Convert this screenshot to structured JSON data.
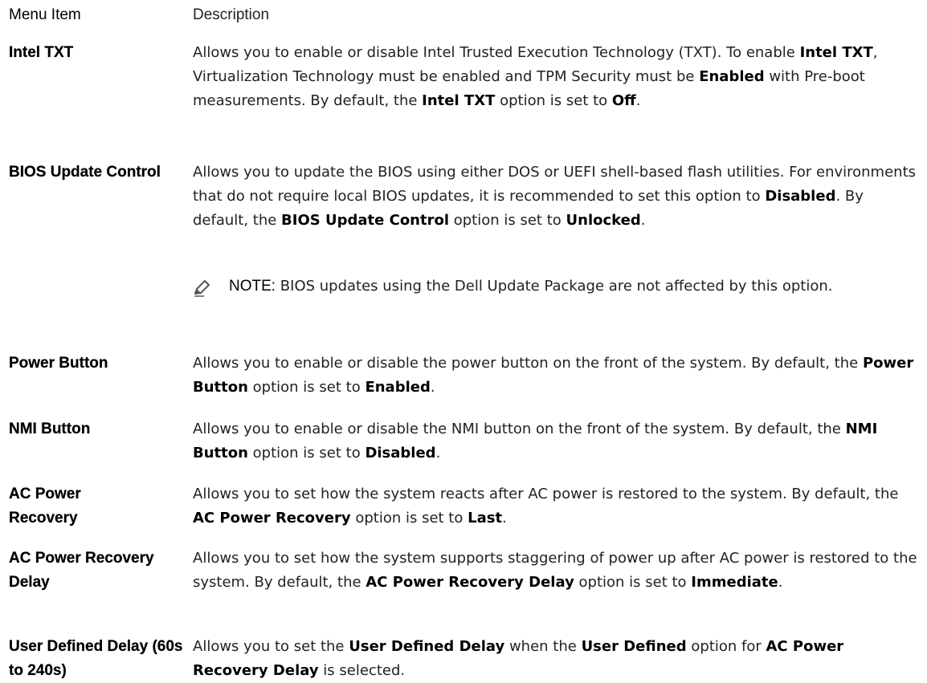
{
  "header": {
    "menu_item": "Menu Item",
    "description": "Description"
  },
  "rows": [
    {
      "item": "Intel TXT",
      "parts": [
        {
          "t": "Allows you to enable or disable Intel Trusted Execution Technology (TXT). To enable "
        },
        {
          "t": "Intel TXT",
          "b": true
        },
        {
          "t": ", Virtualization Technology must be enabled and TPM Security must be "
        },
        {
          "t": "Enabled",
          "b": true
        },
        {
          "t": " with Pre-boot measurements. By default, the "
        },
        {
          "t": "Intel TXT",
          "b": true
        },
        {
          "t": " option is set to "
        },
        {
          "t": "Off",
          "b": true
        },
        {
          "t": "."
        }
      ]
    },
    {
      "item": "BIOS Update Control",
      "parts": [
        {
          "t": "Allows you to update the BIOS using either DOS or UEFI shell-based flash utilities. For environments that do not require local BIOS updates, it is recommended to set this option to "
        },
        {
          "t": "Disabled",
          "b": true
        },
        {
          "t": ". By default, the "
        },
        {
          "t": "BIOS Update Control",
          "b": true
        },
        {
          "t": " option is set to "
        },
        {
          "t": "Unlocked",
          "b": true
        },
        {
          "t": "."
        }
      ],
      "note": {
        "label": "NOTE:",
        "text": " BIOS updates using the Dell Update Package are not affected by this option."
      }
    },
    {
      "item": "Power Button",
      "parts": [
        {
          "t": "Allows you to enable or disable the power button on the front of the system. By default, the "
        },
        {
          "t": "Power Button",
          "b": true
        },
        {
          "t": " option is set to "
        },
        {
          "t": "Enabled",
          "b": true
        },
        {
          "t": "."
        }
      ]
    },
    {
      "item": "NMI Button",
      "parts": [
        {
          "t": "Allows you to enable or disable the NMI button on the front of the system. By default, the "
        },
        {
          "t": "NMI Button",
          "b": true
        },
        {
          "t": " option is set to "
        },
        {
          "t": "Disabled",
          "b": true
        },
        {
          "t": "."
        }
      ]
    },
    {
      "item": "AC Power Recovery",
      "parts": [
        {
          "t": "Allows you to set how the system reacts after AC power is restored to the system. By default, the "
        },
        {
          "t": "AC Power Recovery",
          "b": true
        },
        {
          "t": " option is set to "
        },
        {
          "t": "Last",
          "b": true
        },
        {
          "t": "."
        }
      ]
    },
    {
      "item": "AC Power Recovery Delay",
      "parts": [
        {
          "t": "Allows you to set how the system supports staggering of power up after AC power is restored to the system. By default, the "
        },
        {
          "t": "AC Power Recovery Delay",
          "b": true
        },
        {
          "t": " option is set to "
        },
        {
          "t": "Immediate",
          "b": true
        },
        {
          "t": "."
        }
      ]
    },
    {
      "item": "User Defined Delay (60s to 240s)",
      "parts": [
        {
          "t": "Allows you to set the "
        },
        {
          "t": "User Defined Delay",
          "b": true
        },
        {
          "t": " when the "
        },
        {
          "t": "User Defined",
          "b": true
        },
        {
          "t": " option for "
        },
        {
          "t": "AC Power Recovery Delay",
          "b": true
        },
        {
          "t": " is selected."
        }
      ]
    }
  ],
  "icons": {
    "note": "pencil-note-icon"
  },
  "colors": {
    "text": "#222222",
    "heading": "#000000",
    "background": "#ffffff"
  }
}
